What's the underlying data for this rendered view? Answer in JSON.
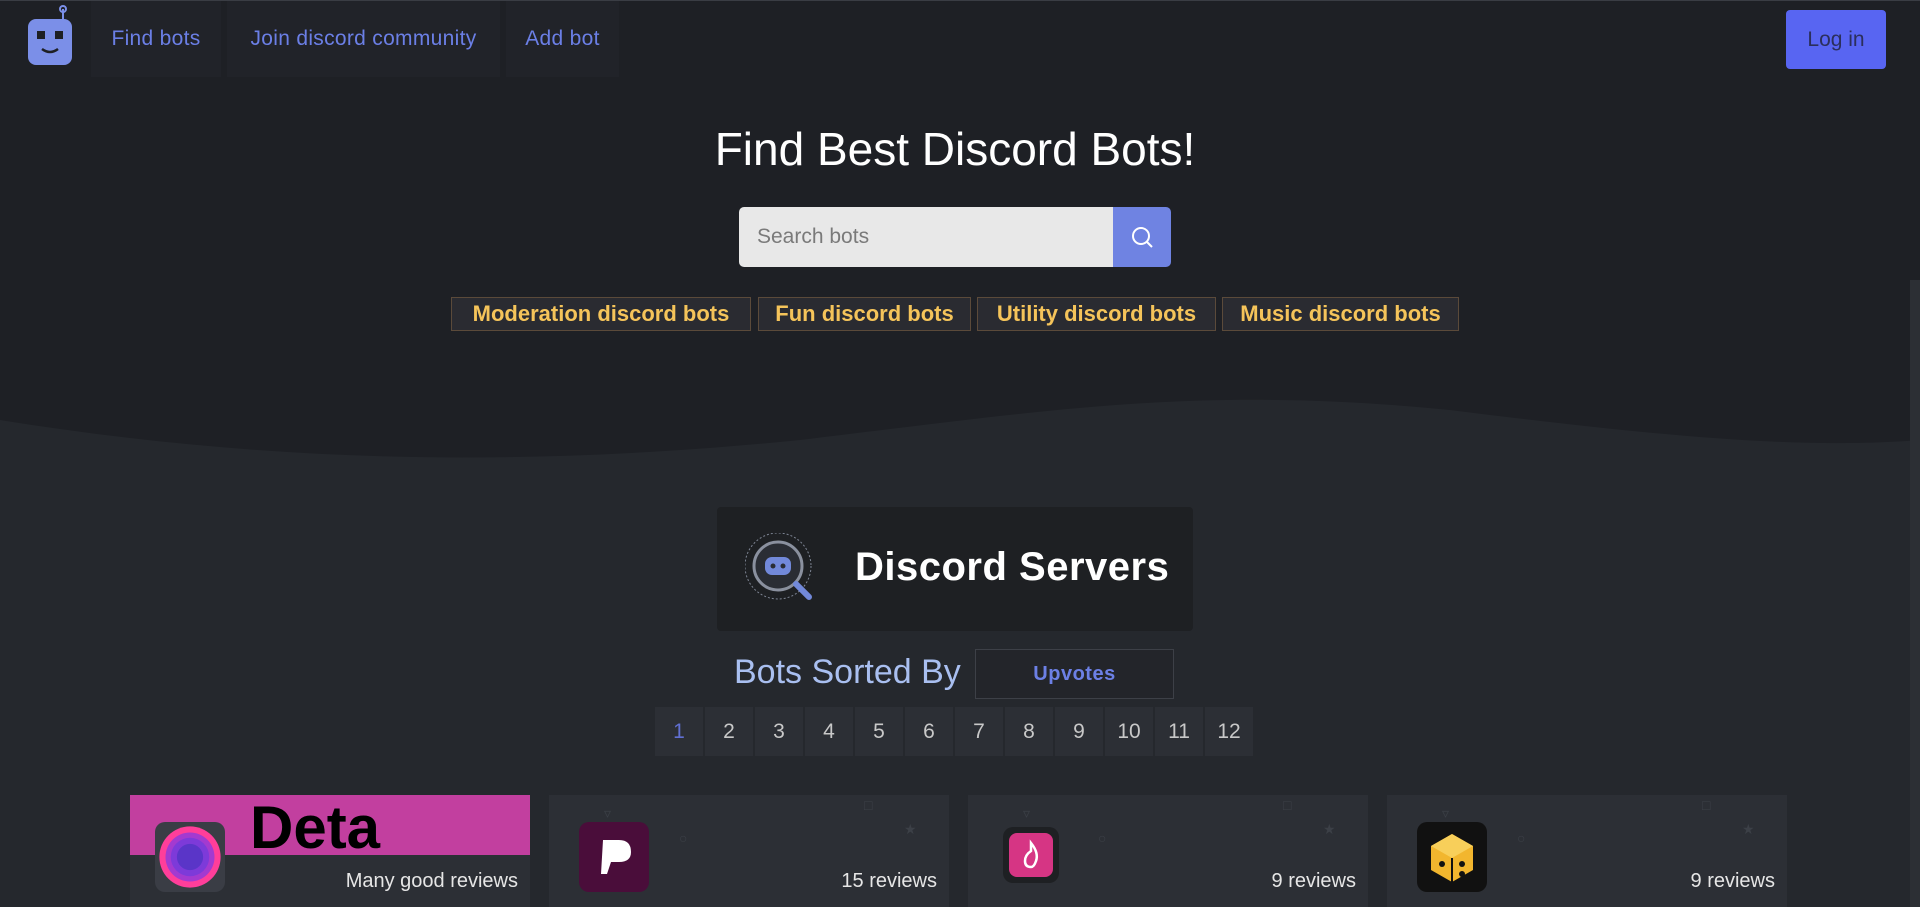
{
  "nav": {
    "logo_icon": "robot-logo-icon",
    "links": [
      "Find bots",
      "Join discord community",
      "Add bot"
    ],
    "login_label": "Log in"
  },
  "hero": {
    "title": "Find Best Discord Bots!",
    "search_placeholder": "Search bots",
    "search_icon": "search-icon",
    "tags": [
      "Moderation discord bots",
      "Fun discord bots",
      "Utility discord bots",
      "Music discord bots"
    ]
  },
  "servers": {
    "label": "Discord Servers",
    "icon": "discord-search-icon"
  },
  "sort": {
    "label": "Bots Sorted By",
    "value": "Upvotes"
  },
  "pagination": {
    "pages": [
      "1",
      "2",
      "3",
      "4",
      "5",
      "6",
      "7",
      "8",
      "9",
      "10",
      "11",
      "12"
    ],
    "current": "1"
  },
  "cards": [
    {
      "banner": "Deta",
      "reviews": "Many good reviews",
      "avatar_icon": "purple-ring-avatar"
    },
    {
      "banner": "",
      "reviews": "15 reviews",
      "avatar_icon": "p-letter-avatar"
    },
    {
      "banner": "",
      "reviews": "9 reviews",
      "avatar_icon": "flame-avatar"
    },
    {
      "banner": "",
      "reviews": "9 reviews",
      "avatar_icon": "gold-cube-avatar"
    }
  ],
  "colors": {
    "accent": "#5865f2",
    "link": "#6b7fe6",
    "tag_text": "#f5c45a",
    "banner": "#c23f9f"
  }
}
